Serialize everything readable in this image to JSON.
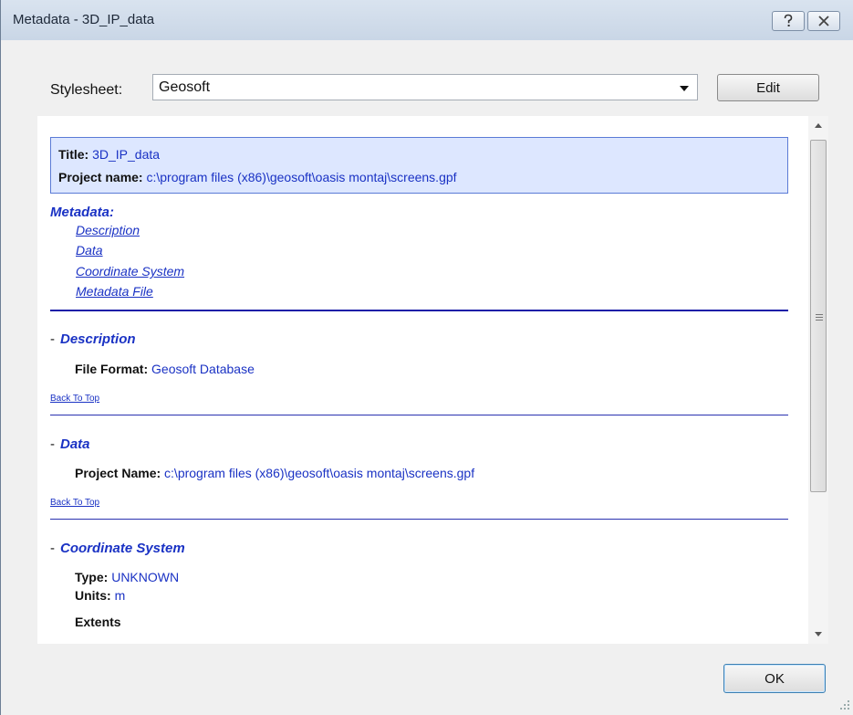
{
  "window": {
    "title": "Metadata - 3D_IP_data",
    "help_button": "?",
    "close_button": "✕"
  },
  "toolbar": {
    "stylesheet_label": "Stylesheet:",
    "stylesheet_value": "Geosoft",
    "edit_label": "Edit"
  },
  "header": {
    "title_label": "Title:",
    "title_value": "3D_IP_data",
    "project_label": "Project name:",
    "project_value": "c:\\program files (x86)\\geosoft\\oasis montaj\\screens.gpf"
  },
  "metadata": {
    "heading": "Metadata:",
    "links": [
      "Description",
      "Data",
      "Coordinate System",
      "Metadata File"
    ]
  },
  "sections": {
    "description": {
      "heading": "Description",
      "file_format_label": "File Format:",
      "file_format_value": "Geosoft Database",
      "back_to_top": "Back To Top"
    },
    "data": {
      "heading": "Data",
      "project_label": "Project Name:",
      "project_value": "c:\\program files (x86)\\geosoft\\oasis montaj\\screens.gpf",
      "back_to_top": "Back To Top"
    },
    "coordinate_system": {
      "heading": "Coordinate System",
      "type_label": "Type:",
      "type_value": "UNKNOWN",
      "units_label": "Units:",
      "units_value": "m",
      "extents_label": "Extents"
    }
  },
  "footer": {
    "ok_label": "OK"
  },
  "colors": {
    "link": "#1a32c4",
    "header_box": "#dde7ff",
    "rule": "#1a1fa8"
  },
  "icons": {
    "dash_marker": "-"
  }
}
